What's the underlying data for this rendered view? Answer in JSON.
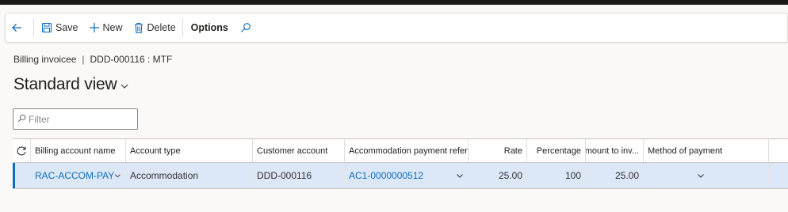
{
  "toolbar": {
    "back_icon": "arrow-left-icon",
    "save_label": "Save",
    "new_label": "New",
    "delete_label": "Delete",
    "options_label": "Options",
    "search_icon": "search-icon"
  },
  "breadcrumb": {
    "parent": "Billing invoicee",
    "separator": "|",
    "record": "DDD-000116 : MTF"
  },
  "view": {
    "title": "Standard view"
  },
  "filter": {
    "placeholder": "Filter"
  },
  "grid": {
    "columns": [
      "Billing account name",
      "Account type",
      "Customer account",
      "Accommodation payment reference",
      "Rate",
      "Percentage",
      "Amount to inv...",
      "Method of payment"
    ],
    "rows": [
      {
        "billing_account_name": "RAC-ACCOM-PAY",
        "account_type": "Accommodation",
        "customer_account": "DDD-000116",
        "accommodation_payment_reference": "AC1-0000000512",
        "rate": "25.00",
        "percentage": "100",
        "amount_to_invoice": "25.00",
        "method_of_payment": ""
      }
    ]
  },
  "colors": {
    "accent": "#0f6cbd",
    "selected_row": "#dce8f7",
    "background": "#faf9f8"
  }
}
